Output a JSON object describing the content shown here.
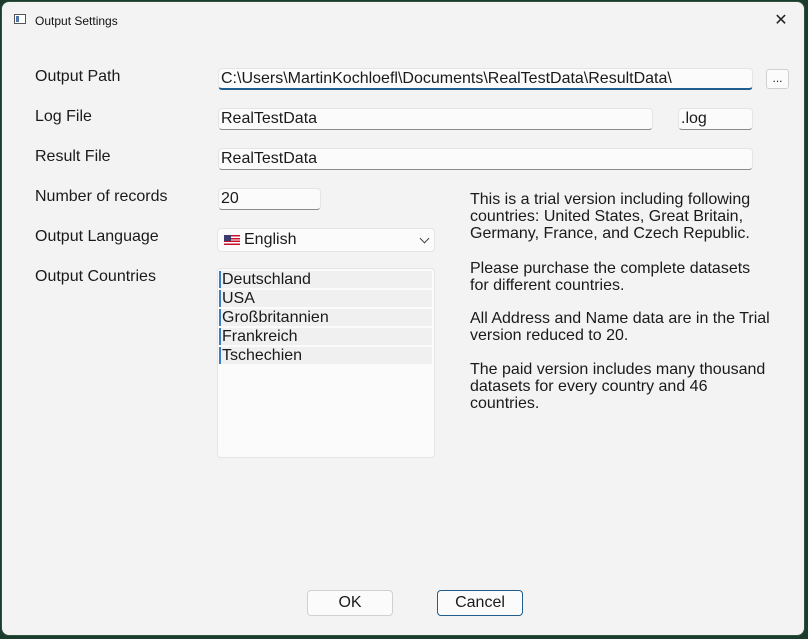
{
  "window": {
    "title": "Output Settings",
    "close_glyph": "✕",
    "icon": "app-window-icon"
  },
  "form": {
    "output_path": {
      "label": "Output Path",
      "value": "C:\\Users\\MartinKochloefl\\Documents\\RealTestData\\ResultData\\",
      "browse_label": "..."
    },
    "log_file": {
      "label": "Log File",
      "value": "RealTestData",
      "extension": ".log"
    },
    "result_file": {
      "label": "Result File",
      "value": "RealTestData"
    },
    "records": {
      "label": "Number of records",
      "value": "20"
    },
    "language": {
      "label": "Output Language",
      "selected": "English",
      "flag_icon": "us-flag-icon"
    },
    "countries": {
      "label": "Output Countries",
      "items": [
        "Deutschland",
        "USA",
        "Großbritannien",
        "Frankreich",
        "Tschechien"
      ]
    }
  },
  "info": {
    "p1": "This is a trial version including following countries: United States, Great Britain, Germany, France, and Czech Republic.",
    "p2": "Please purchase the complete datasets for different countries.",
    "p3": "All Address and Name data are in the Trial version reduced to 20.",
    "p4": "The paid version includes many thousand datasets for every country and 46 countries."
  },
  "buttons": {
    "ok": "OK",
    "cancel": "Cancel"
  }
}
